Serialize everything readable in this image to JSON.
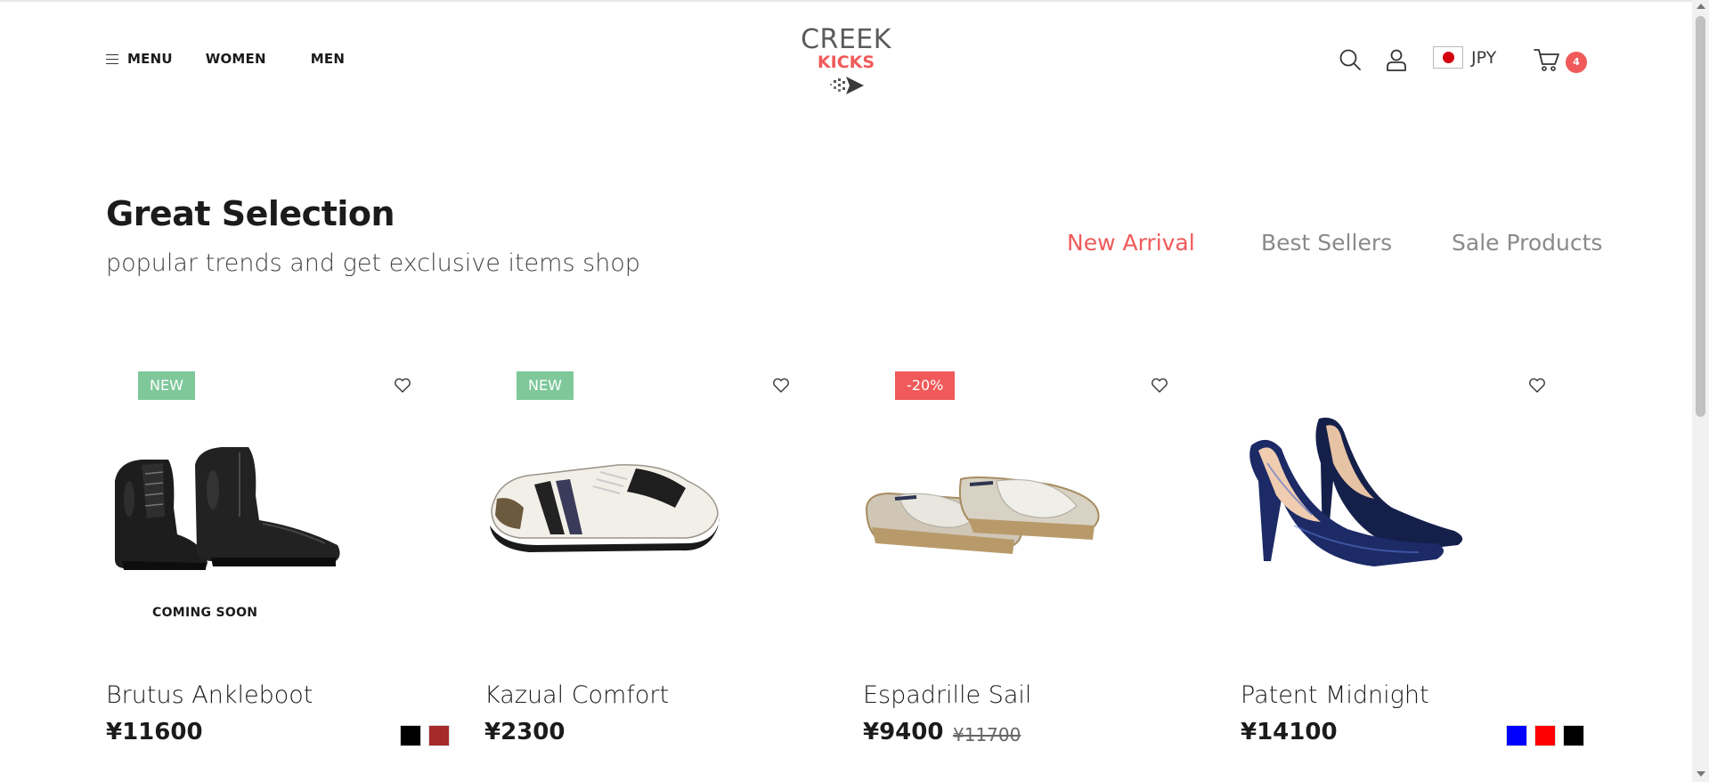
{
  "header": {
    "nav": {
      "menu_label": "MENU",
      "women_label": "WOMEN",
      "men_label": "MEN"
    },
    "logo": {
      "line1": "CREEK",
      "line2": "KICKS"
    },
    "currency": "JPY",
    "cart_count": "4",
    "icons": [
      "hamburger-icon",
      "search-icon",
      "user-icon",
      "japan-flag-icon",
      "cart-icon"
    ]
  },
  "section": {
    "title": "Great Selection",
    "subtitle": "popular trends and get exclusive items shop",
    "tabs": [
      {
        "label": "New Arrival",
        "active": true
      },
      {
        "label": "Best Sellers",
        "active": false
      },
      {
        "label": "Sale Products",
        "active": false
      }
    ]
  },
  "products": [
    {
      "badge": "NEW",
      "overlay": "COMING SOON",
      "name": "Brutus Ankleboot",
      "price": "¥11600",
      "colors": [
        "#000000",
        "#a52a2a"
      ]
    },
    {
      "badge": "NEW",
      "name": "Kazual Comfort",
      "price": "¥2300",
      "colors": []
    },
    {
      "badge": "-20%",
      "name": "Espadrille Sail",
      "price": "¥9400",
      "old_price": "¥11700",
      "colors": []
    },
    {
      "name": "Patent Midnight",
      "price": "¥14100",
      "colors": [
        "#0000ff",
        "#ff0000",
        "#000000"
      ]
    }
  ],
  "theme": {
    "accent": "#f05a5a",
    "new_badge": "#7ec89a",
    "text": "#1b1b1b"
  }
}
